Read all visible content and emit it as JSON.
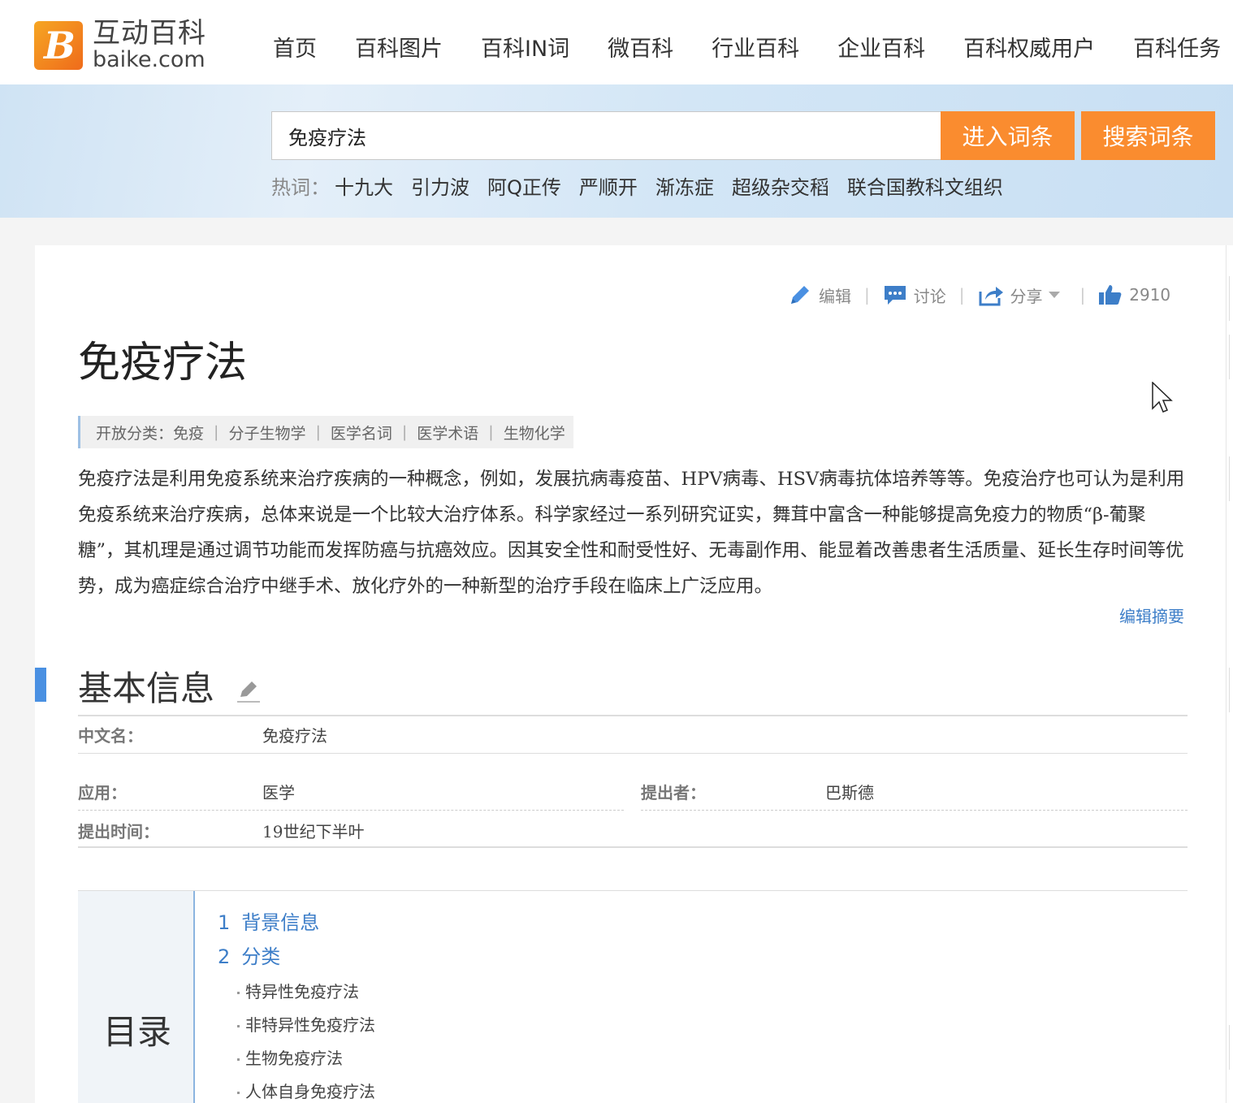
{
  "header": {
    "logo_cn": "互动百科",
    "logo_en": "baike.com",
    "nav": [
      "首页",
      "百科图片",
      "百科IN词",
      "微百科",
      "行业百科",
      "企业百科",
      "百科权威用户",
      "百科任务"
    ]
  },
  "search": {
    "value": "免疫疗法",
    "enter_label": "进入词条",
    "search_label": "搜索词条",
    "hot_label": "热词：",
    "hot_words": [
      "十九大",
      "引力波",
      "阿Q正传",
      "严顺开",
      "渐冻症",
      "超级杂交稻",
      "联合国教科文组织"
    ]
  },
  "actions": {
    "edit": "编辑",
    "discuss": "讨论",
    "share": "分享",
    "likes": "2910"
  },
  "article": {
    "title": "免疫疗法",
    "categories_label": "开放分类：",
    "categories": [
      "免疫",
      "分子生物学",
      "医学名词",
      "医学术语",
      "生物化学"
    ],
    "summary": "免疫疗法是利用免疫系统来治疗疾病的一种概念，例如，发展抗病毒疫苗、HPV病毒、HSV病毒抗体培养等等。免疫治疗也可认为是利用免疫系统来治疗疾病，总体来说是一个比较大治疗体系。科学家经过一系列研究证实，舞茸中富含一种能够提高免疫力的物质“β-葡聚糖”，其机理是通过调节功能而发挥防癌与抗癌效应。因其安全性和耐受性好、无毒副作用、能显着改善患者生活质量、延长生存时间等优势，成为癌症综合治疗中继手术、放化疗外的一种新型的治疗手段在临床上广泛应用。",
    "edit_summary": "编辑摘要"
  },
  "basic_info": {
    "heading": "基本信息",
    "fields": [
      {
        "label": "中文名：",
        "value": "免疫疗法"
      },
      {
        "label": "应用：",
        "value": "医学"
      },
      {
        "label": "提出者：",
        "value": "巴斯德"
      },
      {
        "label": "提出时间：",
        "value": "19世纪下半叶"
      }
    ]
  },
  "toc": {
    "label": "目录",
    "sections": [
      {
        "num": "1",
        "title": "背景信息"
      },
      {
        "num": "2",
        "title": "分类"
      }
    ],
    "subsections": [
      "特异性免疫疗法",
      "非特异性免疫疗法",
      "生物免疫疗法",
      "人体自身免疫疗法"
    ]
  }
}
